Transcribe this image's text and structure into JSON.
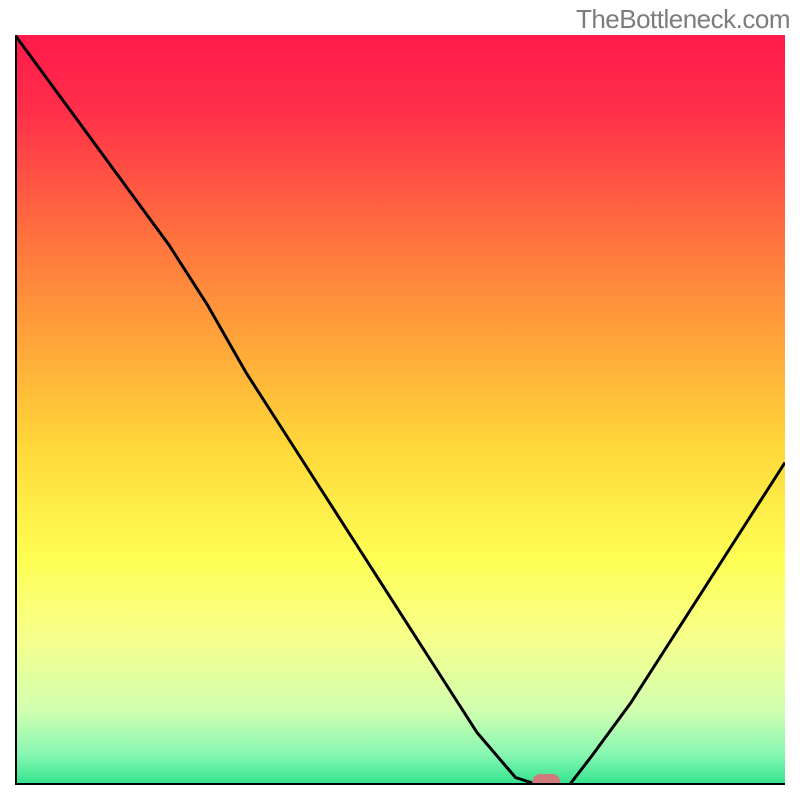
{
  "attribution": "TheBottleneck.com",
  "chart_data": {
    "type": "line",
    "title": "",
    "xlabel": "",
    "ylabel": "",
    "xlim": [
      0,
      100
    ],
    "ylim": [
      0,
      100
    ],
    "x": [
      0,
      5,
      10,
      15,
      20,
      25,
      30,
      35,
      40,
      45,
      50,
      55,
      60,
      65,
      68,
      70,
      72,
      75,
      80,
      85,
      90,
      95,
      100
    ],
    "values": [
      100,
      93,
      86,
      79,
      72,
      64,
      55,
      47,
      39,
      31,
      23,
      15,
      7,
      1,
      0,
      0,
      0,
      4,
      11,
      19,
      27,
      35,
      43
    ],
    "marker_x": 69,
    "gradient_stops": [
      {
        "pos": 0.0,
        "color": "#ff1a4b"
      },
      {
        "pos": 0.1,
        "color": "#ff2f4a"
      },
      {
        "pos": 0.25,
        "color": "#ff6a3f"
      },
      {
        "pos": 0.4,
        "color": "#ffa23a"
      },
      {
        "pos": 0.55,
        "color": "#ffd83a"
      },
      {
        "pos": 0.7,
        "color": "#feff55"
      },
      {
        "pos": 0.8,
        "color": "#f7ff8a"
      },
      {
        "pos": 0.9,
        "color": "#d2ffb0"
      },
      {
        "pos": 0.96,
        "color": "#86f7b3"
      },
      {
        "pos": 1.0,
        "color": "#2fe28b"
      }
    ],
    "axis_color": "#000000",
    "curve_color": "#000000",
    "marker_color": "#cf7b7b"
  }
}
